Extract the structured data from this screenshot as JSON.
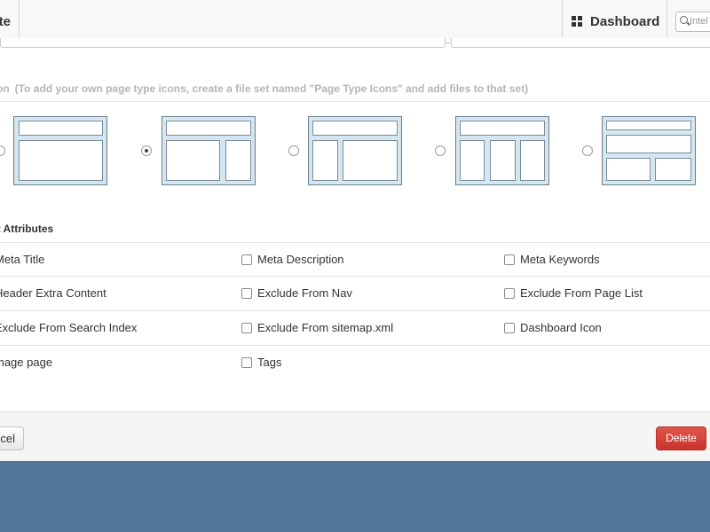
{
  "topbar": {
    "left_item_label": "te",
    "dashboard_label": "Dashboard",
    "dashboard_icon": "grid-icon",
    "search_placeholder": "Intel",
    "search_icon": "magnifier-icon"
  },
  "page_type_icons": {
    "label": "Icon",
    "hint": "(To add your own page type icons, create a file set named \"Page Type Icons\" and add files to that set)",
    "selected_index": 1,
    "options": [
      "full-width",
      "main-right-sidebar",
      "left-sidebar-main",
      "three-column",
      "header-two-boxes"
    ]
  },
  "attributes": {
    "heading": "Default Attributes",
    "heading_visible": "ult Attributes",
    "rows": [
      [
        "Meta Title",
        "Meta Description",
        "Meta Keywords"
      ],
      [
        "Header Extra Content",
        "Exclude From Nav",
        "Exclude From Page List"
      ],
      [
        "Exclude From Search Index",
        "Exclude From sitemap.xml",
        "Dashboard Icon"
      ],
      [
        "Thumbnail image page",
        "Tags",
        ""
      ]
    ],
    "visible_first_column": [
      "Meta Title",
      "Header Extra Content",
      "Exclude From Search Index",
      "mage page"
    ]
  },
  "footer": {
    "cancel_label": "Cancel",
    "cancel_visible": "cel",
    "delete_label": "Delete"
  },
  "colors": {
    "backdrop": "#54769a",
    "thumbnail_fill": "#d4e6f1",
    "delete_button": "#d9443b"
  }
}
